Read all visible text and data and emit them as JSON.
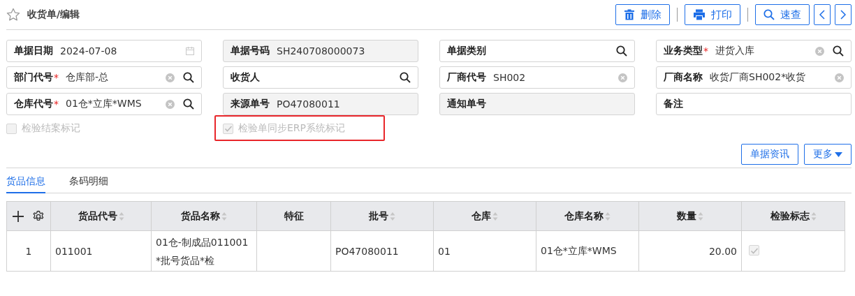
{
  "title": "收货单/编辑",
  "toolbar": [
    {
      "kind": "delete",
      "label": "删除"
    },
    {
      "kind": "print",
      "label": "打印"
    },
    {
      "kind": "search",
      "label": "速查"
    },
    {
      "kind": "prev"
    },
    {
      "kind": "next"
    }
  ],
  "fields": [
    {
      "label": "单据日期",
      "value": "2024-07-08",
      "kind": "date",
      "disabled": false
    },
    {
      "label": "单据号码",
      "value": "SH240708000073",
      "kind": "text",
      "disabled": true
    },
    {
      "label": "单据类别",
      "kind": "lookup",
      "disabled": false
    },
    {
      "label": "业务类型",
      "mark": "*",
      "value": "进货入库",
      "kind": "lookup",
      "disabled": false
    },
    {
      "label": "部门代号",
      "mark": "*",
      "value": "仓库部-总",
      "kind": "lookup",
      "disabled": false
    },
    {
      "label": "收货人",
      "kind": "lookup",
      "disabled": false
    },
    {
      "label": "厂商代号",
      "value": "SH002",
      "kind": "text",
      "disabled": false
    },
    {
      "label": "厂商名称",
      "value": "收货厂商SH002*收货",
      "kind": "text",
      "disabled": false
    },
    {
      "label": "仓库代号",
      "mark": "*",
      "value": "01仓*立库*WMS",
      "kind": "lookup",
      "disabled": false
    },
    {
      "label": "来源单号",
      "value": "PO47080011",
      "kind": "text",
      "disabled": true
    },
    {
      "label": "通知单号",
      "kind": "text",
      "disabled": true
    },
    {
      "label": "备注",
      "kind": "text",
      "disabled": false
    }
  ],
  "flags": [
    {
      "label": "检验结案标记",
      "checked": false,
      "disabled": true,
      "highlighted": false
    },
    {
      "label": "检验单同步ERP系统标记",
      "checked": true,
      "disabled": true,
      "highlighted": true
    }
  ],
  "actions": [
    {
      "label": "单据资讯",
      "kind": "plain"
    },
    {
      "label": "更多",
      "kind": "dropdown"
    }
  ],
  "tabs": [
    {
      "label": "货品信息",
      "selected": true
    },
    {
      "label": "条码明细",
      "selected": false
    }
  ],
  "table": {
    "columns": [
      {
        "kind": "index"
      },
      {
        "label": "货品代号",
        "kind": "text",
        "sortable": true
      },
      {
        "label": "货品名称",
        "kind": "text",
        "sortable": true
      },
      {
        "label": "特征",
        "kind": "text",
        "sortable": false
      },
      {
        "label": "批号",
        "kind": "text",
        "sortable": true
      },
      {
        "label": "仓库",
        "kind": "text",
        "sortable": true
      },
      {
        "label": "仓库名称",
        "kind": "text",
        "sortable": true
      },
      {
        "label": "数量",
        "kind": "number",
        "sortable": true
      },
      {
        "label": "检验标志",
        "kind": "check",
        "sortable": true
      }
    ],
    "rows": [
      {
        "cells": [
          "1",
          "011001",
          "01仓-制成品011001 *批号货品*检",
          "",
          "PO47080011",
          "01",
          "01仓*立库*WMS",
          "20.00",
          {
            "checked": true,
            "disabled": true
          }
        ]
      }
    ]
  }
}
